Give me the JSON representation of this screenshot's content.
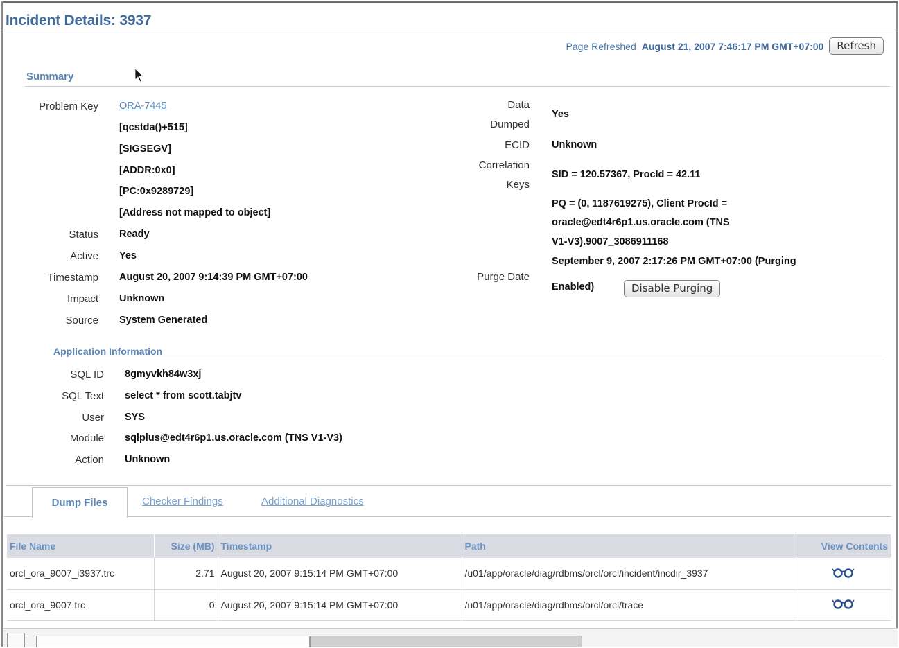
{
  "page": {
    "title": "Incident Details: 3937"
  },
  "refresh": {
    "label": "Page Refreshed",
    "value": "August 21, 2007 7:46:17 PM GMT+07:00",
    "button": "Refresh"
  },
  "summary": {
    "header": "Summary",
    "problem_key_label": "Problem Key",
    "problem_key_link": "ORA-7445",
    "problem_key_lines": [
      "[qcstda()+515]",
      "[SIGSEGV]",
      "[ADDR:0x0]",
      "[PC:0x9289729]",
      "[Address not mapped to object]"
    ],
    "status_label": "Status",
    "status_value": "Ready",
    "active_label": "Active",
    "active_value": "Yes",
    "timestamp_label": "Timestamp",
    "timestamp_value": "August 20, 2007 9:14:39 PM GMT+07:00",
    "impact_label": "Impact",
    "impact_value": "Unknown",
    "source_label": "Source",
    "source_value": "System Generated",
    "data_dumped_label_1": "Data",
    "data_dumped_label_2": "Dumped",
    "data_dumped_value": "Yes",
    "ecid_label": "ECID",
    "ecid_value": "Unknown",
    "correlation_label_1": "Correlation",
    "correlation_label_2": "Keys",
    "correlation_value_1": "SID = 120.57367, ProcId = 42.11",
    "correlation_value_2": "PQ = (0, 1187619275), Client ProcId =",
    "correlation_value_3": "oracle@edt4r6p1.us.oracle.com (TNS",
    "correlation_value_4": "V1-V3).9007_3086911168",
    "purge_label": "Purge Date",
    "purge_value_1": "September 9, 2007 2:17:26 PM GMT+07:00 (Purging",
    "purge_value_2": "Enabled)",
    "disable_purging_button": "Disable Purging"
  },
  "app_info": {
    "header": "Application Information",
    "sql_id_label": "SQL ID",
    "sql_id_value": "8gmyvkh84w3xj",
    "sql_text_label": "SQL Text",
    "sql_text_value": "select * from scott.tabjtv",
    "user_label": "User",
    "user_value": "SYS",
    "module_label": "Module",
    "module_value": "sqlplus@edt4r6p1.us.oracle.com (TNS V1-V3)",
    "action_label": "Action",
    "action_value": "Unknown"
  },
  "tabs": {
    "dump_files": "Dump Files",
    "checker_findings": "Checker Findings",
    "additional_diagnostics": "Additional Diagnostics"
  },
  "table": {
    "headers": {
      "file_name": "File Name",
      "size": "Size (MB)",
      "timestamp": "Timestamp",
      "path": "Path",
      "view": "View Contents"
    },
    "rows": [
      {
        "file_name": "orcl_ora_9007_i3937.trc",
        "size": "2.71",
        "timestamp": "August 20, 2007 9:15:14 PM GMT+07:00",
        "path": "/u01/app/oracle/diag/rdbms/orcl/orcl/incident/incdir_3937"
      },
      {
        "file_name": "orcl_ora_9007.trc",
        "size": "0",
        "timestamp": "August 20, 2007 9:15:14 PM GMT+07:00",
        "path": "/u01/app/oracle/diag/rdbms/orcl/orcl/trace"
      }
    ]
  },
  "icons": {
    "view": "glasses-icon",
    "cursor": "mouse-pointer-icon"
  },
  "colors": {
    "title": "#3f6a9a",
    "section_header": "#5a85b5",
    "link": "#5d8cc0",
    "table_header_bg": "#d9dde3"
  }
}
